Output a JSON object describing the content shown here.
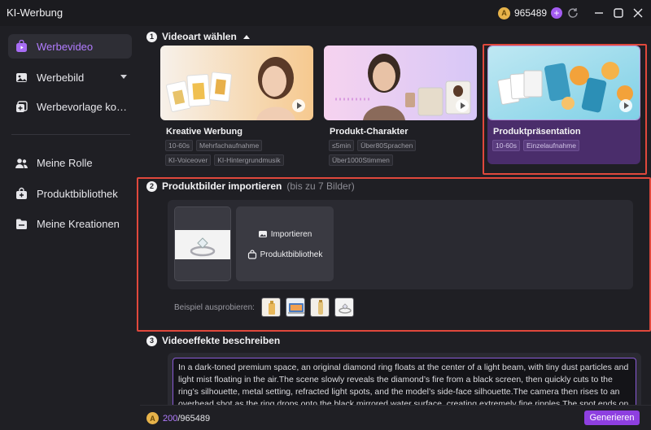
{
  "app": {
    "title": "KI-Werbung",
    "coin_symbol": "A",
    "coin_count": "965489",
    "plus": "+"
  },
  "sidebar": {
    "items": [
      {
        "label": "Werbevideo",
        "icon": "video-bag-icon",
        "active": true
      },
      {
        "label": "Werbebild",
        "icon": "image-icon",
        "has_dropdown": true
      },
      {
        "label": "Werbevorlage kopieren",
        "icon": "copy-plus-icon"
      },
      {
        "label": "Meine Rolle",
        "icon": "users-icon"
      },
      {
        "label": "Produktbibliothek",
        "icon": "bag-plus-icon"
      },
      {
        "label": "Meine Kreationen",
        "icon": "folder-icon"
      }
    ]
  },
  "step1": {
    "number": "1",
    "title": "Videoart wählen",
    "cards": [
      {
        "title": "Kreative Werbung",
        "tags": [
          "10-60s",
          "Mehrfachaufnahme",
          "KI-Voiceover",
          "KI-Hintergrundmusik"
        ],
        "selected": false
      },
      {
        "title": "Produkt-Charakter",
        "tags": [
          "≤5min",
          "Über80Sprachen",
          "Über1000Stimmen"
        ],
        "selected": false
      },
      {
        "title": "Produktpräsentation",
        "tags": [
          "10-60s",
          "Einzelaufnahme"
        ],
        "selected": true
      }
    ]
  },
  "step2": {
    "number": "2",
    "title": "Produktbilder importieren",
    "hint": "(bis zu 7 Bilder)",
    "import_label": "Importieren",
    "library_label": "Produktbibliothek",
    "try_label": "Beispiel ausprobieren:"
  },
  "step3": {
    "number": "3",
    "title": "Videoeffekte beschreiben",
    "description": "In a dark-toned premium space, an original diamond ring floats at the center of a light beam, with tiny dust particles and light mist floating in the air.The scene slowly reveals the diamond’s fire from a black screen, then quickly cuts to the ring’s silhouette, metal setting, refracted light spots, and the model’s side-face silhouette.The camera then rises to an overhead shot as the ring drops onto the black mirrored water surface, creating extremely fine ripples.The spot ends on an ultra-luxurious hero shot of the product.The overall style resembles an annual campaign film for a luxury brand: cold, elegant"
  },
  "footer": {
    "credits_used": "200",
    "credits_total": "/965489",
    "generate_label": "Generieren"
  },
  "colors": {
    "accent": "#8e3fe0",
    "highlight": "#e0483c",
    "active_text": "#b27cff"
  }
}
